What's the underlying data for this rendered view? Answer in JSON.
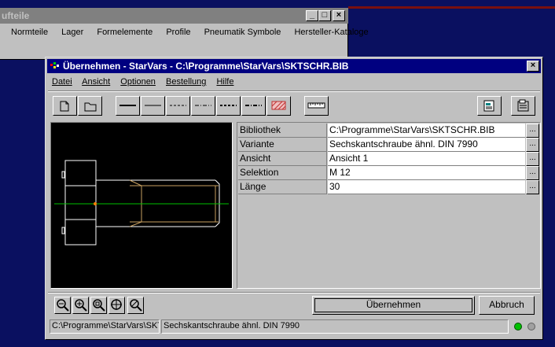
{
  "background_window": {
    "title": "ufteile",
    "menu": [
      "Normteile",
      "Lager",
      "Formelemente",
      "Profile",
      "Pneumatik Symbole",
      "Hersteller-Kataloge"
    ]
  },
  "window": {
    "title": "Übernehmen - StarVars - C:\\Programme\\StarVars\\SKTSCHR.BIB",
    "menu": [
      "Datei",
      "Ansicht",
      "Optionen",
      "Bestellung",
      "Hilfe"
    ],
    "close_glyph": "×"
  },
  "properties": [
    {
      "label": "Bibliothek",
      "value": "C:\\Programme\\StarVars\\SKTSCHR.BIB",
      "button": "..."
    },
    {
      "label": "Variante",
      "value": "Sechskantschraube ähnl. DIN 7990",
      "button": "..."
    },
    {
      "label": "Ansicht",
      "value": "Ansicht 1",
      "button": "..."
    },
    {
      "label": "Selektion",
      "value": "M 12",
      "button": "..."
    },
    {
      "label": "Länge",
      "value": "30",
      "button": "..."
    }
  ],
  "buttons": {
    "apply": "Übernehmen",
    "cancel": "Abbruch"
  },
  "status": {
    "path": "C:\\Programme\\StarVars\\SKTSCHR.BIB",
    "description": "Sechskantschraube ähnl. DIN 7990"
  },
  "colors": {
    "title_active": "#000080",
    "title_inactive": "#808080",
    "desktop": "#0a1060",
    "led_on": "#00c000",
    "led_off": "#808080",
    "drawing_line": "#ffffff",
    "center_line": "#00c000",
    "thread_line": "#c8a060"
  }
}
